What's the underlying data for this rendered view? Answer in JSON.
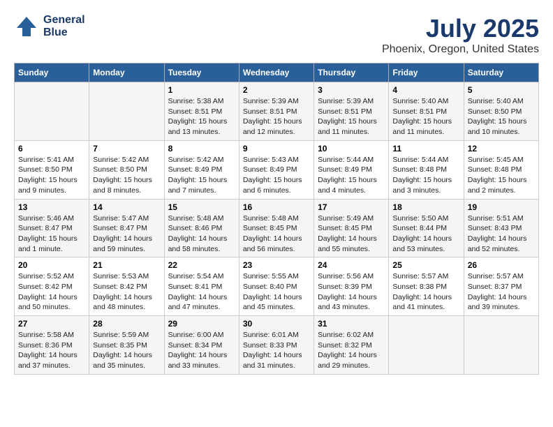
{
  "header": {
    "logo_line1": "General",
    "logo_line2": "Blue",
    "title": "July 2025",
    "subtitle": "Phoenix, Oregon, United States"
  },
  "days_of_week": [
    "Sunday",
    "Monday",
    "Tuesday",
    "Wednesday",
    "Thursday",
    "Friday",
    "Saturday"
  ],
  "weeks": [
    [
      {
        "num": "",
        "info": ""
      },
      {
        "num": "",
        "info": ""
      },
      {
        "num": "1",
        "info": "Sunrise: 5:38 AM\nSunset: 8:51 PM\nDaylight: 15 hours and 13 minutes."
      },
      {
        "num": "2",
        "info": "Sunrise: 5:39 AM\nSunset: 8:51 PM\nDaylight: 15 hours and 12 minutes."
      },
      {
        "num": "3",
        "info": "Sunrise: 5:39 AM\nSunset: 8:51 PM\nDaylight: 15 hours and 11 minutes."
      },
      {
        "num": "4",
        "info": "Sunrise: 5:40 AM\nSunset: 8:51 PM\nDaylight: 15 hours and 11 minutes."
      },
      {
        "num": "5",
        "info": "Sunrise: 5:40 AM\nSunset: 8:50 PM\nDaylight: 15 hours and 10 minutes."
      }
    ],
    [
      {
        "num": "6",
        "info": "Sunrise: 5:41 AM\nSunset: 8:50 PM\nDaylight: 15 hours and 9 minutes."
      },
      {
        "num": "7",
        "info": "Sunrise: 5:42 AM\nSunset: 8:50 PM\nDaylight: 15 hours and 8 minutes."
      },
      {
        "num": "8",
        "info": "Sunrise: 5:42 AM\nSunset: 8:49 PM\nDaylight: 15 hours and 7 minutes."
      },
      {
        "num": "9",
        "info": "Sunrise: 5:43 AM\nSunset: 8:49 PM\nDaylight: 15 hours and 6 minutes."
      },
      {
        "num": "10",
        "info": "Sunrise: 5:44 AM\nSunset: 8:49 PM\nDaylight: 15 hours and 4 minutes."
      },
      {
        "num": "11",
        "info": "Sunrise: 5:44 AM\nSunset: 8:48 PM\nDaylight: 15 hours and 3 minutes."
      },
      {
        "num": "12",
        "info": "Sunrise: 5:45 AM\nSunset: 8:48 PM\nDaylight: 15 hours and 2 minutes."
      }
    ],
    [
      {
        "num": "13",
        "info": "Sunrise: 5:46 AM\nSunset: 8:47 PM\nDaylight: 15 hours and 1 minute."
      },
      {
        "num": "14",
        "info": "Sunrise: 5:47 AM\nSunset: 8:47 PM\nDaylight: 14 hours and 59 minutes."
      },
      {
        "num": "15",
        "info": "Sunrise: 5:48 AM\nSunset: 8:46 PM\nDaylight: 14 hours and 58 minutes."
      },
      {
        "num": "16",
        "info": "Sunrise: 5:48 AM\nSunset: 8:45 PM\nDaylight: 14 hours and 56 minutes."
      },
      {
        "num": "17",
        "info": "Sunrise: 5:49 AM\nSunset: 8:45 PM\nDaylight: 14 hours and 55 minutes."
      },
      {
        "num": "18",
        "info": "Sunrise: 5:50 AM\nSunset: 8:44 PM\nDaylight: 14 hours and 53 minutes."
      },
      {
        "num": "19",
        "info": "Sunrise: 5:51 AM\nSunset: 8:43 PM\nDaylight: 14 hours and 52 minutes."
      }
    ],
    [
      {
        "num": "20",
        "info": "Sunrise: 5:52 AM\nSunset: 8:42 PM\nDaylight: 14 hours and 50 minutes."
      },
      {
        "num": "21",
        "info": "Sunrise: 5:53 AM\nSunset: 8:42 PM\nDaylight: 14 hours and 48 minutes."
      },
      {
        "num": "22",
        "info": "Sunrise: 5:54 AM\nSunset: 8:41 PM\nDaylight: 14 hours and 47 minutes."
      },
      {
        "num": "23",
        "info": "Sunrise: 5:55 AM\nSunset: 8:40 PM\nDaylight: 14 hours and 45 minutes."
      },
      {
        "num": "24",
        "info": "Sunrise: 5:56 AM\nSunset: 8:39 PM\nDaylight: 14 hours and 43 minutes."
      },
      {
        "num": "25",
        "info": "Sunrise: 5:57 AM\nSunset: 8:38 PM\nDaylight: 14 hours and 41 minutes."
      },
      {
        "num": "26",
        "info": "Sunrise: 5:57 AM\nSunset: 8:37 PM\nDaylight: 14 hours and 39 minutes."
      }
    ],
    [
      {
        "num": "27",
        "info": "Sunrise: 5:58 AM\nSunset: 8:36 PM\nDaylight: 14 hours and 37 minutes."
      },
      {
        "num": "28",
        "info": "Sunrise: 5:59 AM\nSunset: 8:35 PM\nDaylight: 14 hours and 35 minutes."
      },
      {
        "num": "29",
        "info": "Sunrise: 6:00 AM\nSunset: 8:34 PM\nDaylight: 14 hours and 33 minutes."
      },
      {
        "num": "30",
        "info": "Sunrise: 6:01 AM\nSunset: 8:33 PM\nDaylight: 14 hours and 31 minutes."
      },
      {
        "num": "31",
        "info": "Sunrise: 6:02 AM\nSunset: 8:32 PM\nDaylight: 14 hours and 29 minutes."
      },
      {
        "num": "",
        "info": ""
      },
      {
        "num": "",
        "info": ""
      }
    ]
  ]
}
